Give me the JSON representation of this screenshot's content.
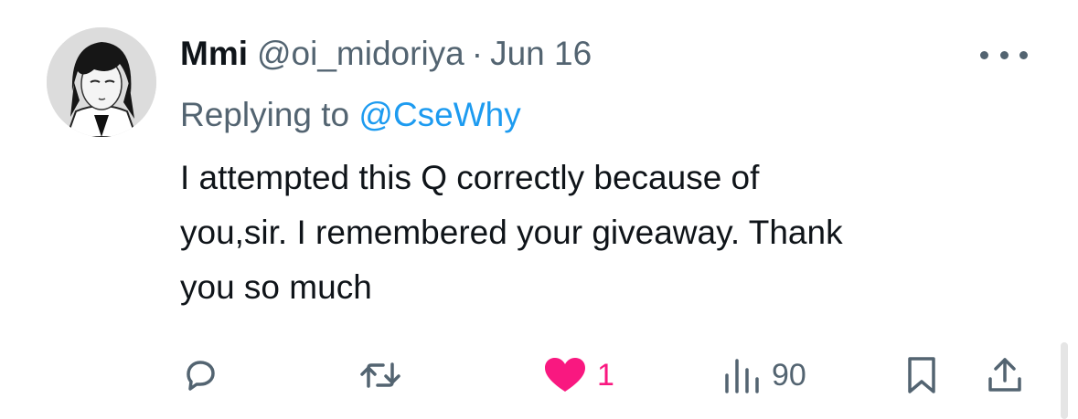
{
  "tweet": {
    "author_name": "Mmi",
    "handle": "@oi_midoriya",
    "separator": "·",
    "date": "Jun 16",
    "replying_prefix": "Replying to",
    "replying_to": "@CseWhy",
    "text_lines": [
      "I attempted this Q correctly because of",
      "you,sir. I remembered your giveaway. Thank",
      "you so much"
    ]
  },
  "actions": {
    "reply_icon": "reply-icon",
    "retweet_icon": "retweet-icon",
    "like_icon": "heart-filled-icon",
    "like_count": "1",
    "views_icon": "views-bar-chart-icon",
    "view_count": "90",
    "bookmark_icon": "bookmark-icon",
    "share_icon": "share-upload-icon"
  },
  "colors": {
    "text": "#0f1419",
    "secondary": "#536471",
    "link": "#1d9bf0",
    "like": "#f91880"
  }
}
